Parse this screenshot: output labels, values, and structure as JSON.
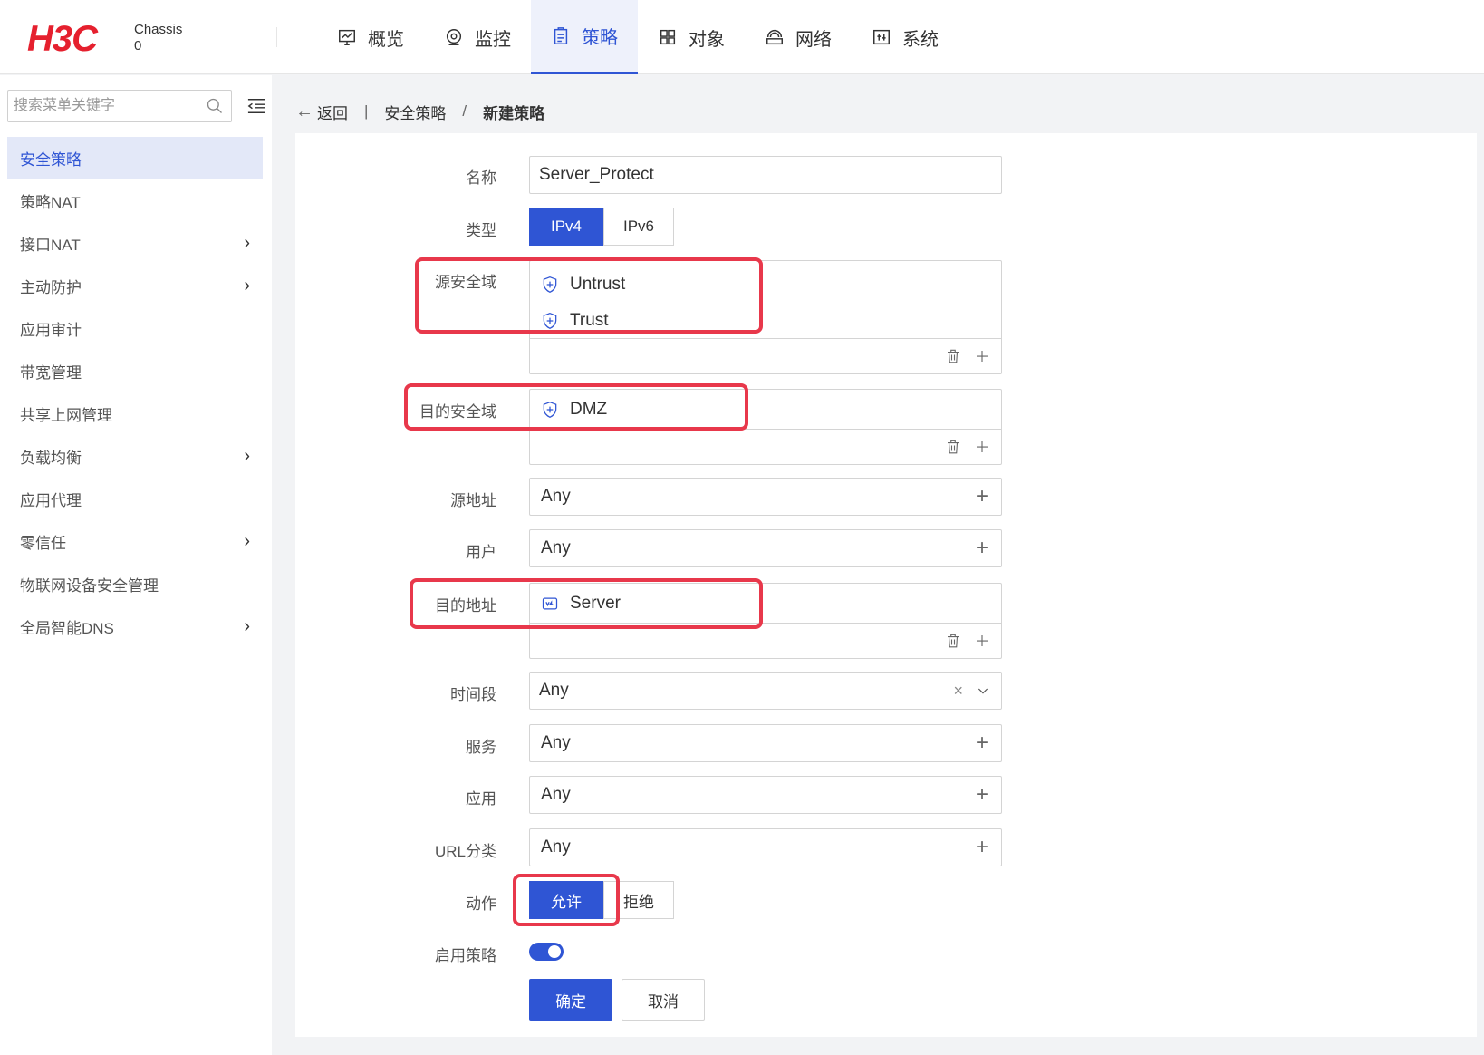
{
  "header": {
    "logo": "H3C",
    "chassis_line1": "Chassis",
    "chassis_line2": "0",
    "nav": [
      {
        "label": "概览",
        "icon": "monitor-icon"
      },
      {
        "label": "监控",
        "icon": "target-icon"
      },
      {
        "label": "策略",
        "icon": "clipboard-icon",
        "active": true
      },
      {
        "label": "对象",
        "icon": "grid-icon"
      },
      {
        "label": "网络",
        "icon": "network-icon"
      },
      {
        "label": "系统",
        "icon": "system-icon"
      }
    ]
  },
  "sidebar": {
    "search_placeholder": "搜索菜单关键字",
    "items": [
      {
        "label": "安全策略",
        "active": true,
        "expandable": false
      },
      {
        "label": "策略NAT",
        "expandable": false
      },
      {
        "label": "接口NAT",
        "expandable": true
      },
      {
        "label": "主动防护",
        "expandable": true
      },
      {
        "label": "应用审计",
        "expandable": false
      },
      {
        "label": "带宽管理",
        "expandable": false
      },
      {
        "label": "共享上网管理",
        "expandable": false
      },
      {
        "label": "负载均衡",
        "expandable": true
      },
      {
        "label": "应用代理",
        "expandable": false
      },
      {
        "label": "零信任",
        "expandable": true
      },
      {
        "label": "物联网设备安全管理",
        "expandable": false
      },
      {
        "label": "全局智能DNS",
        "expandable": true
      }
    ]
  },
  "breadcrumb": {
    "back": "返回",
    "sep1": "|",
    "parent": "安全策略",
    "sep2": "/",
    "current": "新建策略"
  },
  "form": {
    "name_label": "名称",
    "name_value": "Server_Protect",
    "type_label": "类型",
    "type_options": [
      "IPv4",
      "IPv6"
    ],
    "type_selected": "IPv4",
    "src_zone_label": "源安全域",
    "src_zones": [
      "Untrust",
      "Trust"
    ],
    "dst_zone_label": "目的安全域",
    "dst_zones": [
      "DMZ"
    ],
    "src_addr_label": "源地址",
    "src_addr_value": "Any",
    "user_label": "用户",
    "user_value": "Any",
    "dst_addr_label": "目的地址",
    "dst_addrs": [
      "Server"
    ],
    "time_label": "时间段",
    "time_value": "Any",
    "service_label": "服务",
    "service_value": "Any",
    "app_label": "应用",
    "app_value": "Any",
    "url_label": "URL分类",
    "url_value": "Any",
    "action_label": "动作",
    "action_options": [
      "允许",
      "拒绝"
    ],
    "action_selected": "允许",
    "enable_label": "启用策略",
    "enable_on": true,
    "ok_label": "确定",
    "cancel_label": "取消"
  },
  "colors": {
    "brand_red": "#e5202e",
    "accent_blue": "#2f55d4",
    "highlight_red": "#e8384b"
  }
}
